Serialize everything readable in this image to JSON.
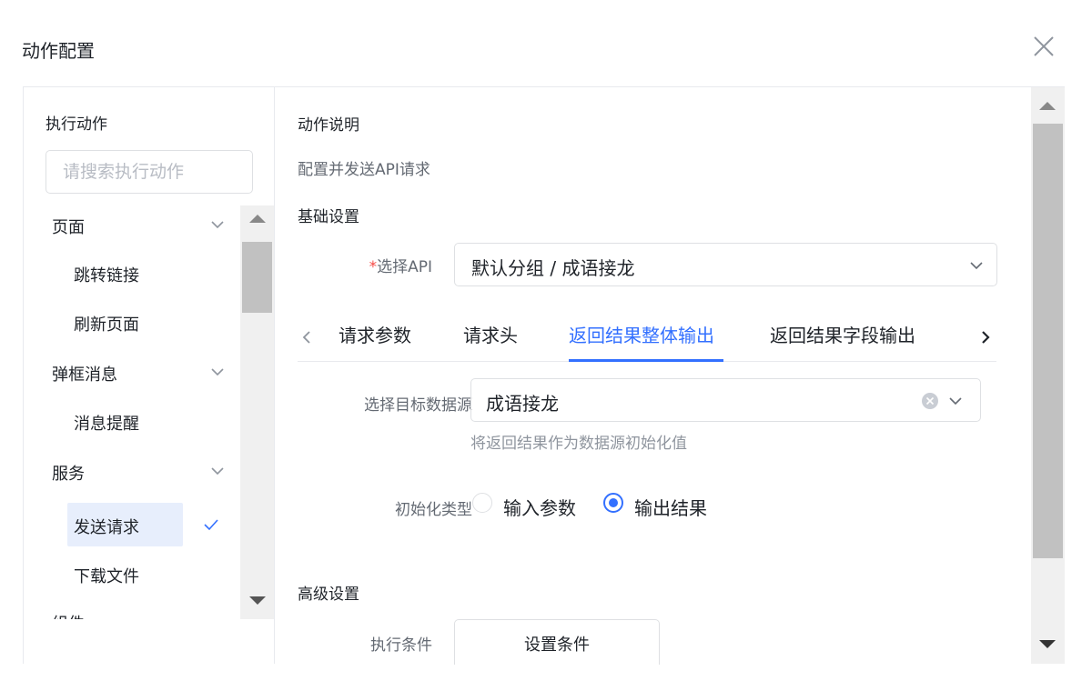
{
  "dialog": {
    "title": "动作配置"
  },
  "left": {
    "heading": "执行动作",
    "search_placeholder": "请搜索执行动作",
    "groups": [
      {
        "label": "页面",
        "items": [
          "跳转链接",
          "刷新页面"
        ]
      },
      {
        "label": "弹框消息",
        "items": [
          "消息提醒"
        ]
      },
      {
        "label": "服务",
        "items": [
          "发送请求",
          "下载文件"
        ]
      },
      {
        "label": "组件"
      }
    ],
    "selected_item": "发送请求"
  },
  "right": {
    "desc_heading": "动作说明",
    "desc_text": "配置并发送API请求",
    "basic_heading": "基础设置",
    "api": {
      "required_mark": "*",
      "label": "选择API",
      "value": "默认分组 / 成语接龙"
    },
    "tabs": [
      "请求参数",
      "请求头",
      "返回结果整体输出",
      "返回结果字段输出"
    ],
    "active_tab": "返回结果整体输出",
    "datasource": {
      "label": "选择目标数据源",
      "value": "成语接龙",
      "hint": "将返回结果作为数据源初始化值"
    },
    "init_type": {
      "label": "初始化类型",
      "options": [
        "输入参数",
        "输出结果"
      ],
      "selected": "输出结果"
    },
    "advanced_heading": "高级设置",
    "condition": {
      "label": "执行条件",
      "button": "设置条件"
    }
  },
  "colors": {
    "accent": "#3370ff",
    "required": "#f54a45",
    "selected_bg": "#e7eefc"
  }
}
